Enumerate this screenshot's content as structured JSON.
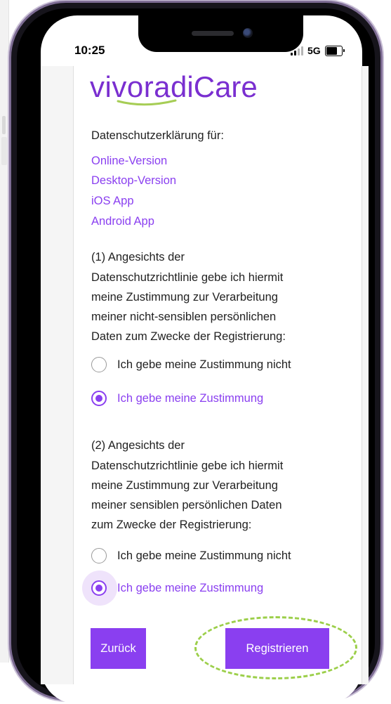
{
  "status_bar": {
    "time": "10:25",
    "network": "5G"
  },
  "logo": {
    "brand": "vivora",
    "product": "diCare"
  },
  "privacy": {
    "heading": "Datenschutzerklärung für:",
    "links": [
      "Online-Version",
      "Desktop-Version",
      "iOS App",
      "Android App"
    ]
  },
  "consent1": {
    "lines": [
      "(1) Angesichts der",
      "Datenschutzrichtlinie gebe ich hiermit",
      "meine Zustimmung zur Verarbeitung",
      "meiner nicht-sensiblen persönlichen",
      "Daten zum Zwecke der Registrierung:"
    ],
    "option_no": "Ich gebe meine Zustimmung nicht",
    "option_yes": "Ich gebe meine Zustimmung",
    "selected": "yes"
  },
  "consent2": {
    "lines": [
      "(2) Angesichts der",
      "Datenschutzrichtlinie gebe ich hiermit",
      "meine Zustimmung zur Verarbeitung",
      "meiner sensiblen persönlichen Daten",
      "zum Zwecke der Registrierung:"
    ],
    "option_no": "Ich gebe meine Zustimmung nicht",
    "option_yes": "Ich gebe meine Zustimmung",
    "selected": "yes"
  },
  "buttons": {
    "back": "Zurück",
    "register": "Registrieren"
  },
  "colors": {
    "accent": "#8a3ff0",
    "highlight": "#9ccf4a"
  }
}
